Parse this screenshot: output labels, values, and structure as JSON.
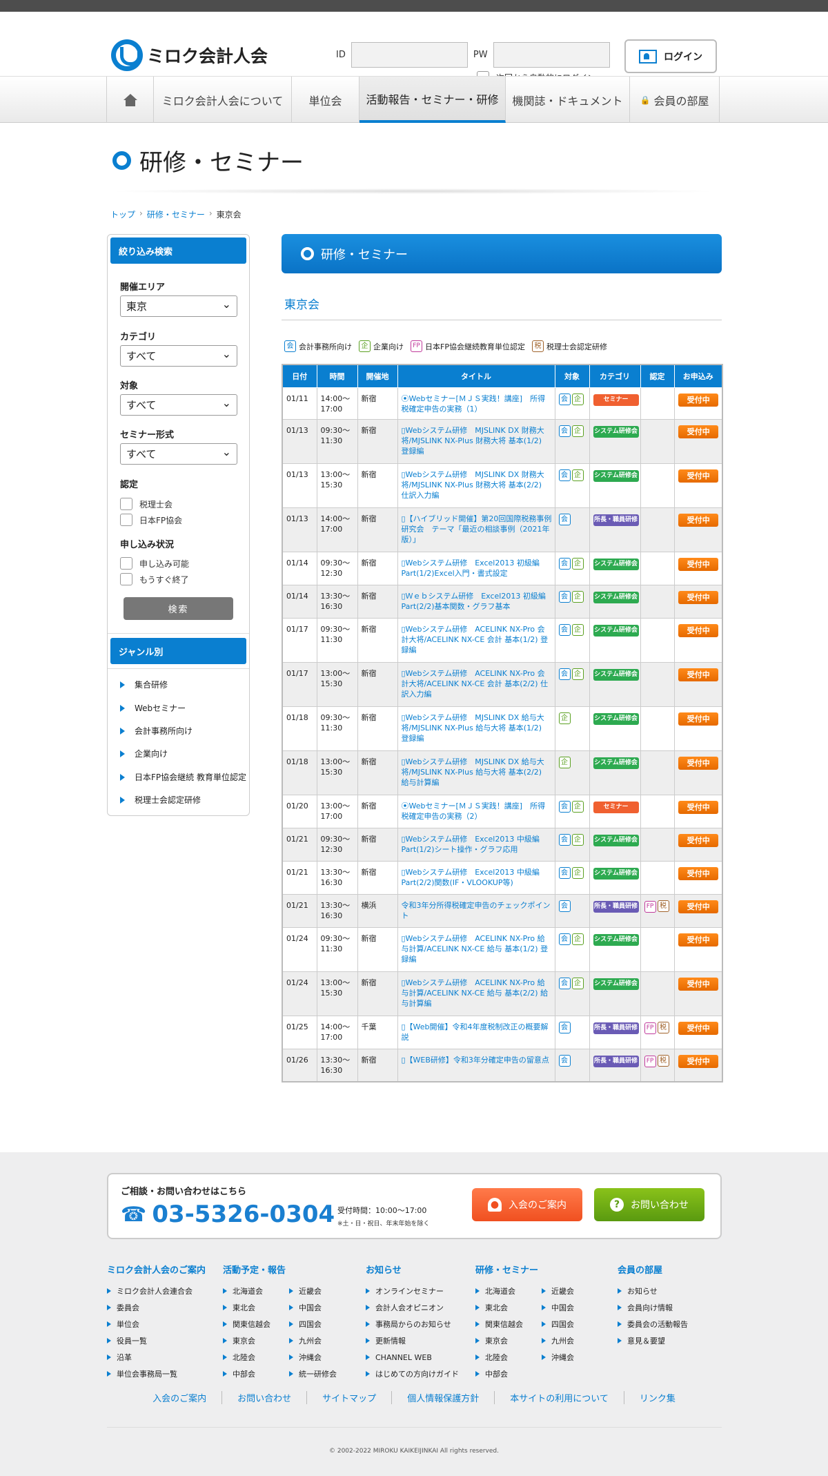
{
  "brand": {
    "name": "ミロク会計人会"
  },
  "login": {
    "id_label": "ID",
    "pw_label": "PW",
    "auto_label": "次回から自動的にログイン",
    "button": "ログイン"
  },
  "nav": [
    "ミロク会計人会について",
    "単位会",
    "活動報告・セミナー・研修",
    "機関誌・ドキュメント",
    "会員の部屋"
  ],
  "page": {
    "title": "研修・セミナー"
  },
  "breadcrumb": [
    "トップ",
    "研修・セミナー",
    "東京会"
  ],
  "sidebar": {
    "filter_head": "絞り込み検索",
    "area_label": "開催エリア",
    "area_value": "東京",
    "category_label": "カテゴリ",
    "category_value": "すべて",
    "target_label": "対象",
    "target_value": "すべて",
    "format_label": "セミナー形式",
    "format_value": "すべて",
    "cert_label": "認定",
    "cert_opts": [
      "税理士会",
      "日本FP協会"
    ],
    "status_label": "申し込み状況",
    "status_opts": [
      "申し込み可能",
      "もうすぐ終了"
    ],
    "search": "検索",
    "genre_head": "ジャンル別",
    "genres": [
      "集合研修",
      "Webセミナー",
      "会計事務所向け",
      "企業向け",
      "日本FP協会継続 教育単位認定",
      "税理士会認定研修"
    ]
  },
  "main": {
    "head": "研修・セミナー",
    "sub": "東京会"
  },
  "legend": [
    {
      "b": "会",
      "t": "会計事務所向け"
    },
    {
      "b": "企",
      "t": "企業向け"
    },
    {
      "b": "FP",
      "t": "日本FP協会継続教育単位認定"
    },
    {
      "b": "税",
      "t": "税理士会認定研修"
    }
  ],
  "table": {
    "headers": [
      "日付",
      "時間",
      "開催地",
      "タイトル",
      "対象",
      "カテゴリ",
      "認定",
      "お申込み"
    ],
    "rows": [
      {
        "date": "01/11",
        "time": "14:00〜17:00",
        "place": "新宿",
        "title": "⦿Webセミナー[ＭＪＳ実践！講座]　所得税確定申告の実務（1）",
        "target": [
          "会",
          "企"
        ],
        "cat": "セミナー",
        "ct": "sem",
        "cert": [],
        "apply": "受付中"
      },
      {
        "date": "01/13",
        "time": "09:30〜11:30",
        "place": "新宿",
        "title": "▯Webシステム研修　MJSLINK DX 財務大将/MJSLINK NX-Plus 財務大将 基本(1/2) 登録編",
        "target": [
          "会",
          "企"
        ],
        "cat": "システム研修会",
        "ct": "sys",
        "cert": [],
        "apply": "受付中"
      },
      {
        "date": "01/13",
        "time": "13:00〜15:30",
        "place": "新宿",
        "title": "▯Webシステム研修　MJSLINK DX 財務大将/MJSLINK NX-Plus 財務大将 基本(2/2) 仕訳入力編",
        "target": [
          "会",
          "企"
        ],
        "cat": "システム研修会",
        "ct": "sys",
        "cert": [],
        "apply": "受付中"
      },
      {
        "date": "01/13",
        "time": "14:00〜17:00",
        "place": "新宿",
        "title": "▯【ハイブリッド開催】第20回国際税務事例研究会　テーマ「最近の相談事例（2021年版）」",
        "target": [
          "会"
        ],
        "cat": "所長・職員研修",
        "ct": "sho",
        "cert": [],
        "apply": "受付中"
      },
      {
        "date": "01/14",
        "time": "09:30〜12:30",
        "place": "新宿",
        "title": "▯Webシステム研修　Excel2013 初級編Part(1/2)Excel入門・書式設定",
        "target": [
          "会",
          "企"
        ],
        "cat": "システム研修会",
        "ct": "sys",
        "cert": [],
        "apply": "受付中"
      },
      {
        "date": "01/14",
        "time": "13:30〜16:30",
        "place": "新宿",
        "title": "▯Ｗｅｂシステム研修　Excel2013 初級編Part(2/2)基本関数・グラフ基本",
        "target": [
          "会",
          "企"
        ],
        "cat": "システム研修会",
        "ct": "sys",
        "cert": [],
        "apply": "受付中"
      },
      {
        "date": "01/17",
        "time": "09:30〜11:30",
        "place": "新宿",
        "title": "▯Webシステム研修　ACELINK NX-Pro 会計大将/ACELINK NX-CE 会計 基本(1/2) 登録編",
        "target": [
          "会",
          "企"
        ],
        "cat": "システム研修会",
        "ct": "sys",
        "cert": [],
        "apply": "受付中"
      },
      {
        "date": "01/17",
        "time": "13:00〜15:30",
        "place": "新宿",
        "title": "▯Webシステム研修　ACELINK NX-Pro 会計大将/ACELINK NX-CE 会計 基本(2/2) 仕訳入力編",
        "target": [
          "会",
          "企"
        ],
        "cat": "システム研修会",
        "ct": "sys",
        "cert": [],
        "apply": "受付中"
      },
      {
        "date": "01/18",
        "time": "09:30〜11:30",
        "place": "新宿",
        "title": "▯Webシステム研修　MJSLINK DX 給与大将/MJSLINK NX-Plus 給与大将 基本(1/2) 登録編",
        "target": [
          "企"
        ],
        "cat": "システム研修会",
        "ct": "sys",
        "cert": [],
        "apply": "受付中"
      },
      {
        "date": "01/18",
        "time": "13:00〜15:30",
        "place": "新宿",
        "title": "▯Webシステム研修　MJSLINK DX 給与大将/MJSLINK NX-Plus 給与大将 基本(2/2) 給与計算編",
        "target": [
          "企"
        ],
        "cat": "システム研修会",
        "ct": "sys",
        "cert": [],
        "apply": "受付中"
      },
      {
        "date": "01/20",
        "time": "13:00〜17:00",
        "place": "新宿",
        "title": "⦿Webセミナー[ＭＪＳ実践！講座]　所得税確定申告の実務（2）",
        "target": [
          "会",
          "企"
        ],
        "cat": "セミナー",
        "ct": "sem",
        "cert": [],
        "apply": "受付中"
      },
      {
        "date": "01/21",
        "time": "09:30〜12:30",
        "place": "新宿",
        "title": "▯Webシステム研修　Excel2013 中級編Part(1/2)シート操作・グラフ応用",
        "target": [
          "会",
          "企"
        ],
        "cat": "システム研修会",
        "ct": "sys",
        "cert": [],
        "apply": "受付中"
      },
      {
        "date": "01/21",
        "time": "13:30〜16:30",
        "place": "新宿",
        "title": "▯Webシステム研修　Excel2013 中級編Part(2/2)関数(IF・VLOOKUP等)",
        "target": [
          "会",
          "企"
        ],
        "cat": "システム研修会",
        "ct": "sys",
        "cert": [],
        "apply": "受付中"
      },
      {
        "date": "01/21",
        "time": "13:30〜16:30",
        "place": "横浜",
        "title": "令和3年分所得税確定申告のチェックポイント",
        "target": [
          "会"
        ],
        "cat": "所長・職員研修",
        "ct": "sho",
        "cert": [
          "FP",
          "税"
        ],
        "apply": "受付中"
      },
      {
        "date": "01/24",
        "time": "09:30〜11:30",
        "place": "新宿",
        "title": "▯Webシステム研修　ACELINK NX-Pro 給与計算/ACELINK NX-CE 給与 基本(1/2) 登録編",
        "target": [
          "会",
          "企"
        ],
        "cat": "システム研修会",
        "ct": "sys",
        "cert": [],
        "apply": "受付中"
      },
      {
        "date": "01/24",
        "time": "13:00〜15:30",
        "place": "新宿",
        "title": "▯Webシステム研修　ACELINK NX-Pro 給与計算/ACELINK NX-CE 給与 基本(2/2) 給与計算編",
        "target": [
          "会",
          "企"
        ],
        "cat": "システム研修会",
        "ct": "sys",
        "cert": [],
        "apply": "受付中"
      },
      {
        "date": "01/25",
        "time": "14:00〜17:00",
        "place": "千葉",
        "title": "▯【Web開催】令和4年度税制改正の概要解説",
        "target": [
          "会"
        ],
        "cat": "所長・職員研修",
        "ct": "sho",
        "cert": [
          "FP",
          "税"
        ],
        "apply": "受付中"
      },
      {
        "date": "01/26",
        "time": "13:30〜16:30",
        "place": "新宿",
        "title": "▯【WEB研修】令和3年分確定申告の留意点",
        "target": [
          "会"
        ],
        "cat": "所長・職員研修",
        "ct": "sho",
        "cert": [
          "FP",
          "税"
        ],
        "apply": "受付中"
      }
    ]
  },
  "footer": {
    "contact_head": "ご相談・お問い合わせはこちら",
    "phone": "03-5326-0304",
    "hours": "受付時間：10:00〜17:00",
    "note": "※土・日・祝日、年末年始を除く",
    "join": "入会のご案内",
    "ask": "お問い合わせ",
    "cols": [
      {
        "h": "ミロク会計人会のご案内",
        "items": [
          "ミロク会計人会連合会",
          "委員会",
          "単位会",
          "役員一覧",
          "沿革",
          "単位会事務局一覧"
        ]
      },
      {
        "h": "活動予定・報告",
        "a": [
          "北海道会",
          "東北会",
          "関東信越会",
          "東京会",
          "北陸会",
          "中部会"
        ],
        "b": [
          "近畿会",
          "中国会",
          "四国会",
          "九州会",
          "沖縄会",
          "統一研修会"
        ]
      },
      {
        "h": "お知らせ",
        "items": [
          "オンラインセミナー",
          "会計人会オピニオン",
          "事務局からのお知らせ",
          "更新情報",
          "CHANNEL WEB",
          "はじめての方向けガイド"
        ]
      },
      {
        "h": "研修・セミナー",
        "a": [
          "北海道会",
          "東北会",
          "関東信越会",
          "東京会",
          "北陸会",
          "中部会"
        ],
        "b": [
          "近畿会",
          "中国会",
          "四国会",
          "九州会",
          "沖縄会"
        ]
      },
      {
        "h": "会員の部屋",
        "items": [
          "お知らせ",
          "会員向け情報",
          "委員会の活動報告",
          "意見＆要望"
        ]
      }
    ],
    "links": [
      "入会のご案内",
      "お問い合わせ",
      "サイトマップ",
      "個人情報保護方針",
      "本サイトの利用について",
      "リンク集"
    ],
    "copyright": "© 2002-2022 MIROKU KAIKEIJINKAI All rights reserved."
  }
}
